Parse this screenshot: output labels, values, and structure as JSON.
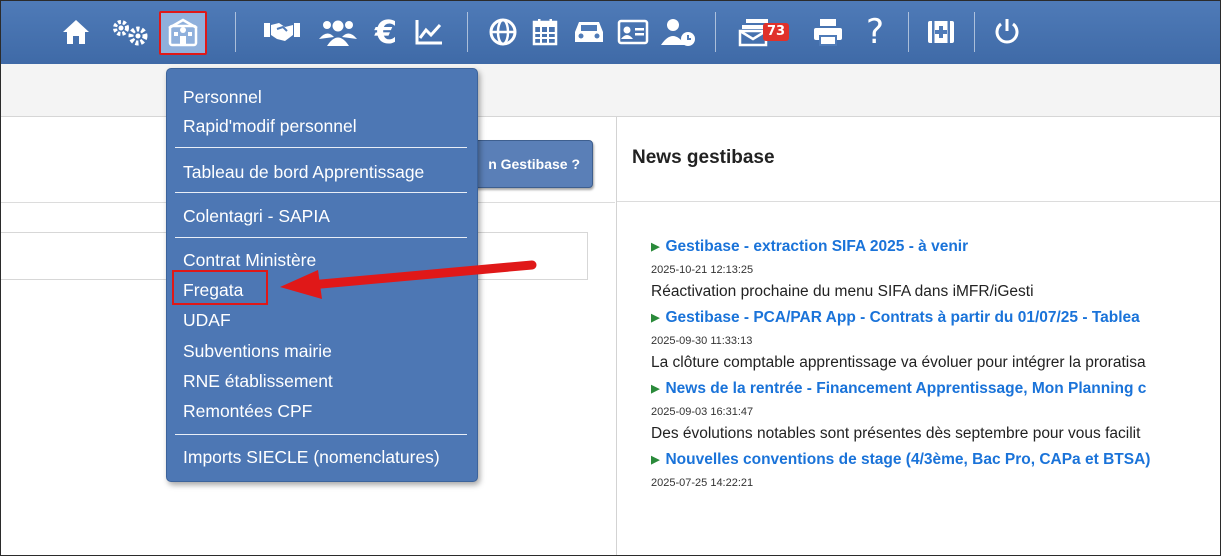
{
  "toolbar": {
    "icons": [
      "home-icon",
      "settings-gears-icon",
      "establishment-icon",
      "handshake-icon",
      "group-icon",
      "euro-icon",
      "chart-icon",
      "globe-icon",
      "calendar-icon",
      "car-icon",
      "id-card-icon",
      "user-clock-icon",
      "mail-notification-icon",
      "printer-icon",
      "help-icon",
      "first-aid-icon",
      "power-icon"
    ],
    "mail_badge": "73",
    "help_label": "?",
    "euro_label": "€",
    "colors": {
      "bar": "#4f7bb8",
      "active_highlight": "#e01818"
    }
  },
  "menu": {
    "items": [
      "Personnel",
      "Rapid'modif personnel",
      "Tableau de bord Apprentissage",
      "Colentagri - SAPIA",
      "Contrat Ministère",
      "Fregata",
      "UDAF",
      "Subventions mairie",
      "RNE établissement",
      "Remontées CPF",
      "Imports SIECLE (nomenclatures)"
    ],
    "highlighted": "Fregata"
  },
  "left": {
    "button_label": "n Gestibase ?"
  },
  "news": {
    "title": "News gestibase",
    "items": [
      {
        "title": "Gestibase - extraction SIFA 2025 - à venir",
        "date": "2025-10-21 12:13:25",
        "body": "Réactivation prochaine du menu SIFA dans iMFR/iGesti"
      },
      {
        "title": "Gestibase - PCA/PAR App - Contrats à partir du 01/07/25 - Tablea",
        "date": "2025-09-30 11:33:13",
        "body": "La clôture comptable apprentissage va évoluer pour intégrer la proratisa"
      },
      {
        "title": "News de la rentrée - Financement Apprentissage, Mon Planning c",
        "date": "2025-09-03 16:31:47",
        "body": "Des évolutions notables sont présentes dès septembre pour vous facilit"
      },
      {
        "title": "Nouvelles conventions de stage (4/3ème, Bac Pro, CAPa et BTSA)",
        "date": "2025-07-25 14:22:21",
        "body": ""
      }
    ]
  }
}
